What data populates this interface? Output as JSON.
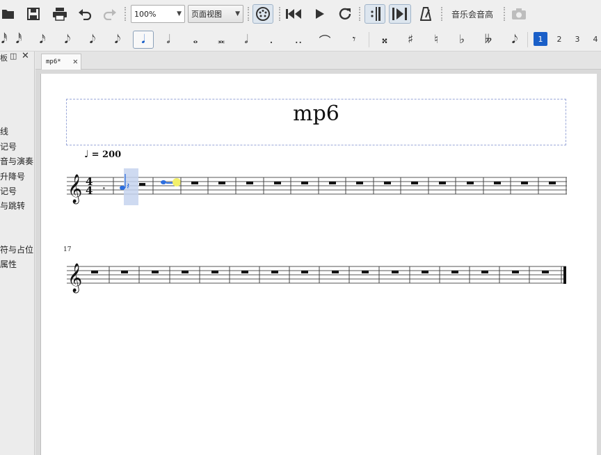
{
  "toolbar": {
    "zoom_value": "100%",
    "view_mode_value": "页面视图",
    "concert_pitch_label": "音乐会音高"
  },
  "palette": {
    "voices": [
      "1",
      "2",
      "3",
      "4"
    ],
    "selected_voice": "1"
  },
  "left_panel": {
    "items": [
      "线",
      "记号",
      "音与演奏",
      "升降号",
      "记号",
      "与跳转",
      "符与占位",
      "属性"
    ]
  },
  "tabs": [
    {
      "label": "mp6*"
    }
  ],
  "score": {
    "title": "mp6",
    "tempo_marking": "= 200",
    "second_system_measure_number": "17",
    "time_signature": {
      "top": "4",
      "bottom": "4"
    }
  },
  "colors": {
    "selection_blue": "#1a5fc8",
    "selection_highlight": "#c6d3ee",
    "cursor_yellow": "#f3f06a",
    "note_blue": "#2d6fe0"
  }
}
